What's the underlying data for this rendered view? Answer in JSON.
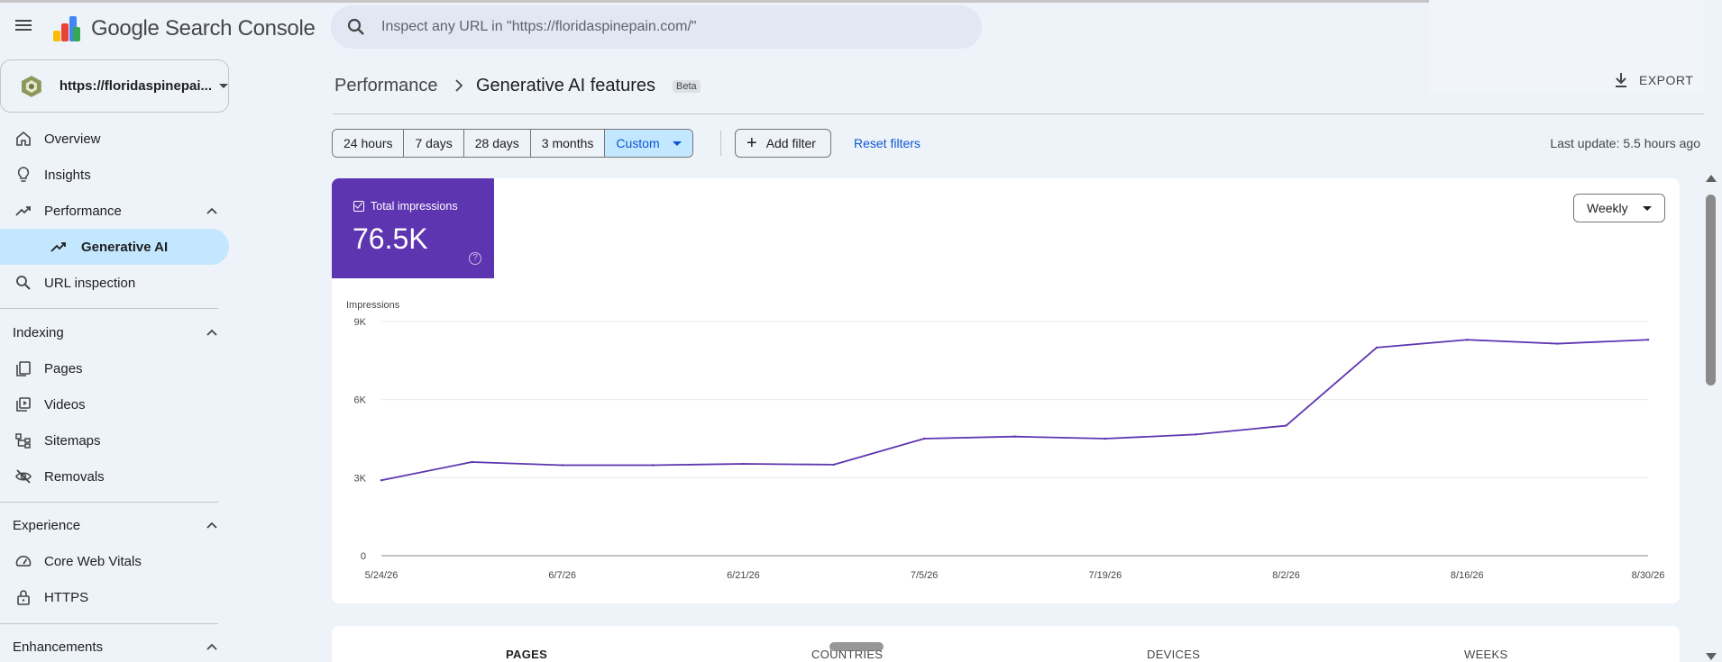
{
  "header": {
    "app_name": "Google Search Console",
    "search_placeholder": "Inspect any URL in \"https://floridaspinepain.com/\"",
    "menu_icon": "hamburger-menu-icon",
    "search_icon": "search-icon"
  },
  "property": {
    "label": "https://floridaspinepai...",
    "icon": "site-favicon"
  },
  "sidebar": {
    "items": [
      {
        "label": "Overview",
        "icon": "home-icon"
      },
      {
        "label": "Insights",
        "icon": "lightbulb-icon"
      },
      {
        "label": "Performance",
        "icon": "trending-up-icon",
        "expanded": true
      },
      {
        "label": "Generative AI",
        "icon": "trending-up-icon",
        "active": true
      },
      {
        "label": "URL inspection",
        "icon": "search-icon"
      }
    ],
    "sections": [
      {
        "title": "Indexing",
        "items": [
          {
            "label": "Pages",
            "icon": "pages-icon"
          },
          {
            "label": "Videos",
            "icon": "video-library-icon"
          },
          {
            "label": "Sitemaps",
            "icon": "sitemap-icon"
          },
          {
            "label": "Removals",
            "icon": "visibility-off-icon"
          }
        ]
      },
      {
        "title": "Experience",
        "items": [
          {
            "label": "Core Web Vitals",
            "icon": "speed-icon"
          },
          {
            "label": "HTTPS",
            "icon": "lock-icon"
          }
        ]
      },
      {
        "title": "Enhancements",
        "items": []
      }
    ]
  },
  "page": {
    "breadcrumb_parent": "Performance",
    "title": "Generative AI features",
    "badge": "Beta",
    "export_label": "EXPORT"
  },
  "filters": {
    "ranges": [
      "24 hours",
      "7 days",
      "28 days",
      "3 months",
      "Custom"
    ],
    "selected": "Custom",
    "add_filter": "Add filter",
    "reset": "Reset filters",
    "last_update": "Last update: 5.5 hours ago"
  },
  "metric": {
    "label": "Total impressions",
    "value": "76.5K",
    "help": "?",
    "color": "#5e35b1"
  },
  "granularity": "Weekly",
  "chart_data": {
    "type": "line",
    "ylabel": "Impressions",
    "yticks": [
      "0",
      "3K",
      "6K",
      "9K"
    ],
    "ylim": [
      0,
      9000
    ],
    "xticks": [
      "5/24/26",
      "6/7/26",
      "6/21/26",
      "7/5/26",
      "7/19/26",
      "8/2/26",
      "8/16/26",
      "8/30/26"
    ],
    "x": [
      "5/24/26",
      "5/31/26",
      "6/7/26",
      "6/14/26",
      "6/21/26",
      "6/28/26",
      "7/5/26",
      "7/12/26",
      "7/19/26",
      "7/26/26",
      "8/2/26",
      "8/9/26",
      "8/16/26",
      "8/23/26",
      "8/30/26"
    ],
    "series": [
      {
        "values": [
          2900,
          3600,
          3480,
          3480,
          3530,
          3500,
          4500,
          4580,
          4500,
          4660,
          5000,
          8000,
          8300,
          8150,
          8300
        ],
        "color": "#5e35b1"
      }
    ],
    "grid": true
  },
  "tabs": [
    "PAGES",
    "COUNTRIES",
    "DEVICES",
    "WEEKS"
  ]
}
